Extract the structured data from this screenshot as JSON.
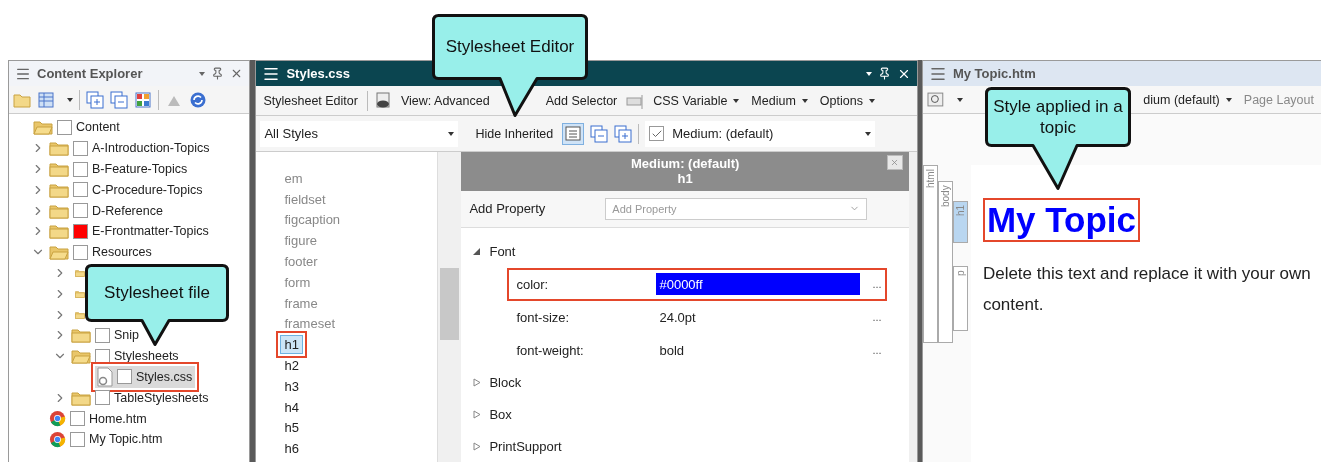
{
  "callouts": [
    {
      "text": "Stylesheet Editor"
    },
    {
      "text": "Style applied in a topic"
    },
    {
      "text": "Stylesheet file"
    }
  ],
  "content_explorer": {
    "title": "Content Explorer",
    "tree": [
      {
        "kind": "root",
        "label": "Content",
        "selected": false,
        "annotated": false,
        "children": [
          {
            "kind": "folder",
            "label": "A-Introduction-Topics",
            "expanded": false,
            "selected": false,
            "annotated": false
          },
          {
            "kind": "folder",
            "label": "B-Feature-Topics",
            "expanded": false,
            "selected": false,
            "annotated": false
          },
          {
            "kind": "folder",
            "label": "C-Procedure-Topics",
            "expanded": false,
            "selected": false,
            "annotated": false
          },
          {
            "kind": "folder",
            "label": "D-Reference",
            "expanded": false,
            "selected": false,
            "annotated": false
          },
          {
            "kind": "folder",
            "label": "E-Frontmatter-Topics",
            "expanded": false,
            "selected": false,
            "annotated": false,
            "color": "#ff0000"
          },
          {
            "kind": "folder",
            "label": "Resources",
            "expanded": true,
            "selected": false,
            "annotated": false,
            "children": [
              {
                "kind": "folder",
                "expanded": false
              },
              {
                "kind": "folder",
                "expanded": false
              },
              {
                "kind": "folder",
                "expanded": false
              },
              {
                "kind": "folder",
                "label": "Snip",
                "expanded": false,
                "selected": false,
                "annotated": false
              },
              {
                "kind": "folder",
                "label": "Stylesheets",
                "expanded": true,
                "selected": false,
                "annotated": false,
                "children": [
                  {
                    "kind": "stylesheet",
                    "label": "Styles.css",
                    "selected": true,
                    "annotated": true
                  }
                ]
              },
              {
                "kind": "folder",
                "label": "TableStylesheets",
                "expanded": false,
                "selected": false,
                "annotated": false
              }
            ]
          },
          {
            "kind": "page",
            "label": "Home.htm",
            "selected": false,
            "annotated": false
          },
          {
            "kind": "page",
            "label": "My Topic.htm",
            "selected": false,
            "annotated": false
          }
        ]
      }
    ]
  },
  "stylesheet_editor": {
    "title": "Styles.css",
    "toolbar": [
      {
        "label": "Stylesheet Editor",
        "dropdown": false
      },
      {
        "label": "View: Advanced",
        "dropdown": false
      },
      {
        "label": "Add Selector",
        "dropdown": false
      },
      {
        "label": "CSS Variable",
        "dropdown": true
      },
      {
        "label": "Medium",
        "dropdown": true
      },
      {
        "label": "Options",
        "dropdown": true
      }
    ],
    "filter": {
      "value": "All Styles"
    },
    "hide_inherited": "Hide Inherited",
    "medium": {
      "checked": true,
      "value": "Medium: (default)"
    },
    "selectors": [
      {
        "label": "em",
        "styled": false,
        "selected": false
      },
      {
        "label": "fieldset",
        "styled": false,
        "selected": false
      },
      {
        "label": "figcaption",
        "styled": false,
        "selected": false
      },
      {
        "label": "figure",
        "styled": false,
        "selected": false
      },
      {
        "label": "footer",
        "styled": false,
        "selected": false
      },
      {
        "label": "form",
        "styled": false,
        "selected": false
      },
      {
        "label": "frame",
        "styled": false,
        "selected": false
      },
      {
        "label": "frameset",
        "styled": false,
        "selected": false
      },
      {
        "label": "h1",
        "styled": true,
        "selected": true
      },
      {
        "label": "h2",
        "styled": true,
        "selected": false
      },
      {
        "label": "h3",
        "styled": true,
        "selected": false
      },
      {
        "label": "h4",
        "styled": true,
        "selected": false
      },
      {
        "label": "h5",
        "styled": true,
        "selected": false
      },
      {
        "label": "h6",
        "styled": true,
        "selected": false
      }
    ],
    "properties_header": {
      "medium": "Medium: (default)",
      "selector": "h1"
    },
    "add_property": {
      "label": "Add Property",
      "placeholder": "Add Property"
    },
    "groups": [
      {
        "label": "Font",
        "expanded": true,
        "properties": [
          {
            "name": "color:",
            "value": "#0000ff",
            "selected": true,
            "annotated": true,
            "more": "..."
          },
          {
            "name": "font-size:",
            "value": "24.0pt",
            "selected": false,
            "annotated": false,
            "more": "..."
          },
          {
            "name": "font-weight:",
            "value": "bold",
            "selected": false,
            "annotated": false,
            "more": "..."
          }
        ]
      },
      {
        "label": "Block",
        "expanded": false
      },
      {
        "label": "Box",
        "expanded": false
      },
      {
        "label": "PrintSupport",
        "expanded": false
      }
    ]
  },
  "topic_editor": {
    "title": "My Topic.htm",
    "medium": "dium (default)",
    "page_layout": "Page Layout",
    "structure_bars": [
      {
        "label": "html",
        "selected": false
      },
      {
        "label": "body",
        "selected": false
      },
      {
        "label": "h1",
        "selected": true
      },
      {
        "label": "p",
        "selected": false
      }
    ],
    "heading": {
      "text": "My Topic",
      "annotated": true
    },
    "paragraph": "Delete this text and replace it with your own content."
  }
}
